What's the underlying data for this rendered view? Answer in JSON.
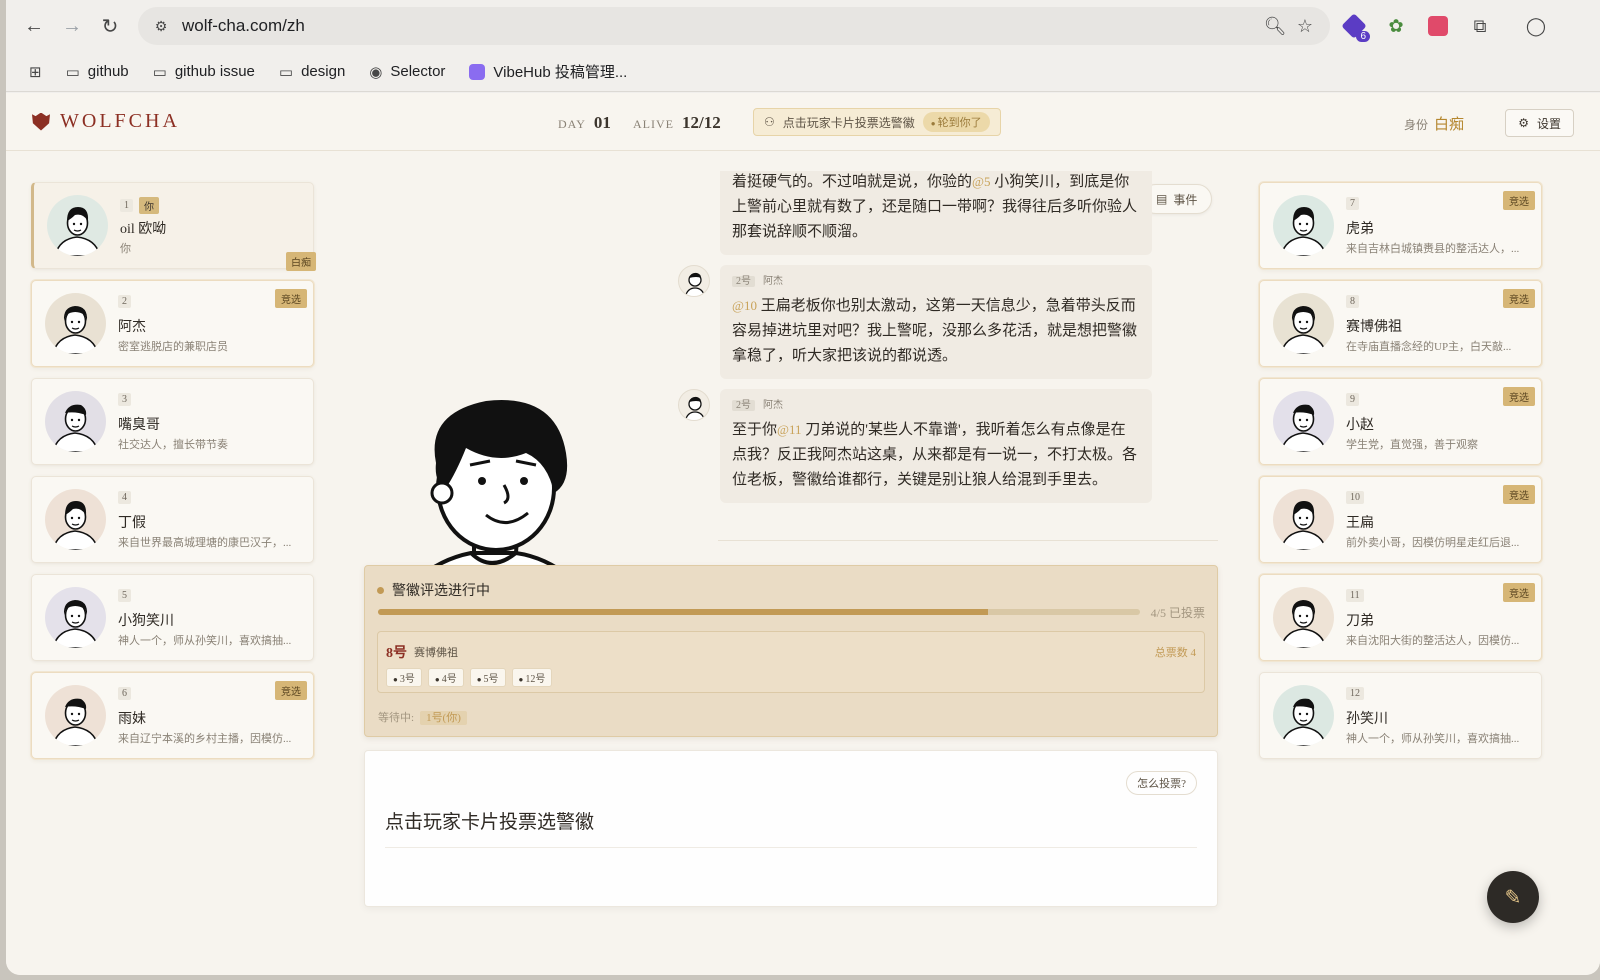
{
  "browser": {
    "url": "wolf-cha.com/zh",
    "ext_badge": "6",
    "bookmarks": [
      {
        "label": "github",
        "icon": "folder-icon"
      },
      {
        "label": "github issue",
        "icon": "folder-icon"
      },
      {
        "label": "design",
        "icon": "folder-icon"
      },
      {
        "label": "Selector",
        "icon": "globe-icon"
      },
      {
        "label": "VibeHub 投稿管理...",
        "icon": "vibehub-icon"
      }
    ]
  },
  "header": {
    "logo": "WOLFCHA",
    "day_label": "DAY",
    "day_value": "01",
    "alive_label": "ALIVE",
    "alive_value": "12/12",
    "hint": "点击玩家卡片投票选警徽",
    "hint_badge": "轮到你了",
    "role_label": "身份",
    "role_value": "白痴",
    "settings": "设置"
  },
  "players_left": [
    {
      "seat": "1",
      "you": "你",
      "name": "oil 欧呦",
      "desc": "你",
      "role_tag": "白痴",
      "bg": "#dfe9e3"
    },
    {
      "seat": "2",
      "name": "阿杰",
      "desc": "密室逃脱店的兼职店员",
      "tag": "竞选",
      "bg": "#e9e1d3"
    },
    {
      "seat": "3",
      "name": "嘴臭哥",
      "desc": "社交达人，擅长带节奏",
      "bg": "#e2dfe6"
    },
    {
      "seat": "4",
      "name": "丁假",
      "desc": "来自世界最高城理塘的康巴汉子，...",
      "bg": "#eee1d6"
    },
    {
      "seat": "5",
      "name": "小狗笑川",
      "desc": "神人一个，师从孙笑川，喜欢搞抽...",
      "bg": "#e4e1ea"
    },
    {
      "seat": "6",
      "name": "雨妹",
      "desc": "来自辽宁本溪的乡村主播，因模仿...",
      "tag": "竞选",
      "bg": "#eee1d6"
    }
  ],
  "players_right": [
    {
      "seat": "7",
      "name": "虎弟",
      "desc": "来自吉林白城镇赉县的整活达人，...",
      "tag": "竞选",
      "bg": "#dce9e3"
    },
    {
      "seat": "8",
      "name": "赛博佛祖",
      "desc": "在寺庙直播念经的UP主，白天敲...",
      "tag": "竞选",
      "bg": "#e8e2d3"
    },
    {
      "seat": "9",
      "name": "小赵",
      "desc": "学生党，直觉强，善于观察",
      "tag": "竞选",
      "bg": "#e3e0ea"
    },
    {
      "seat": "10",
      "name": "王扁",
      "desc": "前外卖小哥，因模仿明星走红后退...",
      "tag": "竞选",
      "bg": "#eee1d6"
    },
    {
      "seat": "11",
      "name": "刀弟",
      "desc": "来自沈阳大街的整活达人，因模仿...",
      "tag": "竞选",
      "bg": "#eee3d6"
    },
    {
      "seat": "12",
      "name": "孙笑川",
      "desc": "神人一个，师从孙笑川，喜欢搞抽...",
      "bg": "#dce8e2"
    }
  ],
  "chat": {
    "events_label": "事件",
    "messages": [
      {
        "seat": "",
        "name": "",
        "pre": "着挺硬气的。不过咱就是说，你验的",
        "mention": "@5",
        "post": " 小狗笑川，到底是你上警前心里就有数了，还是随口一带啊？我得往后多听你验人那套说辞顺不顺溜。"
      },
      {
        "seat": "2号",
        "name": "阿杰",
        "pre": "",
        "mention": "@10",
        "post": " 王扁老板你也别太激动，这第一天信息少，急着带头反而容易掉进坑里对吧？我上警呢，没那么多花活，就是想把警徽拿稳了，听大家把该说的都说透。"
      },
      {
        "seat": "2号",
        "name": "阿杰",
        "pre": "至于你",
        "mention": "@11",
        "post": " 刀弟说的'某些人不靠谱'，我听着怎么有点像是在点我？反正我阿杰站这桌，从来都是有一说一，不打太极。各位老板，警徽给谁都行，关键是别让狼人给混到手里去。"
      }
    ]
  },
  "vote": {
    "title": "警徽评选进行中",
    "progress": 0.8,
    "count": "4/5 已投票",
    "target_seat": "8号",
    "target_name": "赛博佛祖",
    "total": "总票数 4",
    "voters": [
      "3号",
      "4号",
      "5号",
      "12号"
    ],
    "waiting_label": "等待中:",
    "waiting_value": "1号(你)"
  },
  "input": {
    "howto": "怎么投票?",
    "prompt": "点击玩家卡片投票选警徽"
  },
  "colors": {
    "accent": "#c29a55",
    "brand": "#8c2f23",
    "bg": "#f7f4ee"
  }
}
